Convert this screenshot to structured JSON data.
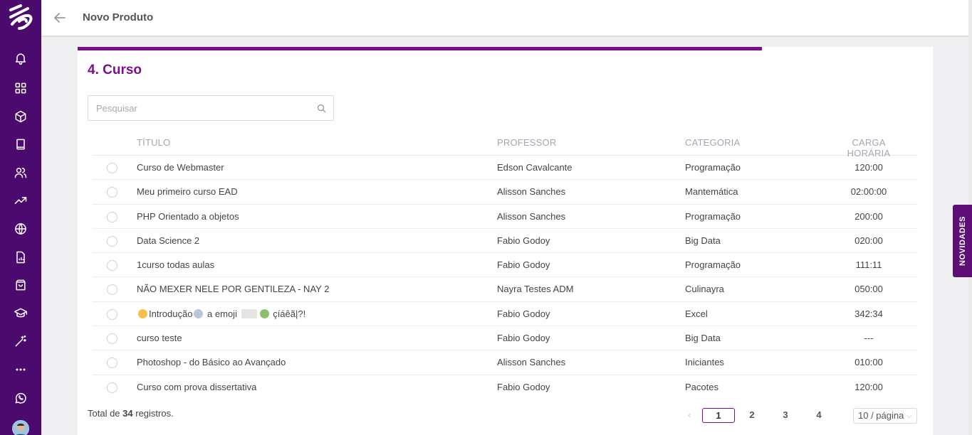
{
  "header": {
    "title": "Novo Produto"
  },
  "sidebar": {
    "items": [
      {
        "icon": "bell-icon",
        "name": "notifications"
      },
      {
        "icon": "grid-icon",
        "name": "dashboard"
      },
      {
        "icon": "cube-icon",
        "name": "products"
      },
      {
        "icon": "book-icon",
        "name": "courses"
      },
      {
        "icon": "users-icon",
        "name": "users"
      },
      {
        "icon": "trend-icon",
        "name": "reports"
      },
      {
        "icon": "globe-icon",
        "name": "site"
      },
      {
        "icon": "document-chart-icon",
        "name": "documents"
      },
      {
        "icon": "bag-icon",
        "name": "store"
      },
      {
        "icon": "graduation-cap-icon",
        "name": "academic"
      },
      {
        "icon": "magic-wand-icon",
        "name": "automation"
      },
      {
        "icon": "more-icon",
        "name": "more"
      },
      {
        "icon": "whatsapp-icon",
        "name": "whatsapp"
      }
    ]
  },
  "card": {
    "progress_percent": 80,
    "section_title": "4. Curso",
    "search_placeholder": "Pesquisar"
  },
  "table": {
    "columns": [
      "TÍTULO",
      "PROFESSOR",
      "CATEGORIA",
      "CARGA HORÁRIA"
    ],
    "rows": [
      {
        "title": "Curso de Webmaster",
        "professor": "Edson Cavalcante",
        "category": "Programação",
        "hours": "120:00"
      },
      {
        "title": "Meu primeiro curso EAD",
        "professor": "Alisson Sanches",
        "category": "Mantemática",
        "hours": "02:00:00"
      },
      {
        "title": "PHP Orientado a objetos",
        "professor": "Alisson Sanches",
        "category": "Programação",
        "hours": "200:00"
      },
      {
        "title": "Data Science 2",
        "professor": "Fabio Godoy",
        "category": "Big Data",
        "hours": "020:00"
      },
      {
        "title": "1curso todas aulas",
        "professor": "Fabio Godoy",
        "category": "Programação",
        "hours": "111:11"
      },
      {
        "title": "NÃO MEXER NELE POR GENTILEZA - NAY 2",
        "professor": "Nayra Testes ADM",
        "category": "Culinayra",
        "hours": "050:00"
      },
      {
        "title_parts": [
          "Introdução",
          " a emoji ",
          " çíáêã|?!"
        ],
        "title_text": "Introdução a emoji çíáêã|?!",
        "professor": "Fabio Godoy",
        "category": "Excel",
        "hours": "342:34"
      },
      {
        "title": "curso teste",
        "professor": "Fabio Godoy",
        "category": "Big Data",
        "hours": "---"
      },
      {
        "title": "Photoshop - do Básico ao Avançado",
        "professor": "Alisson Sanches",
        "category": "Iniciantes",
        "hours": "010:00"
      },
      {
        "title": "Curso com prova dissertativa",
        "professor": "Fabio Godoy",
        "category": "Pacotes",
        "hours": "120:00"
      }
    ]
  },
  "footer": {
    "total_prefix": "Total de ",
    "total_count": "34",
    "total_suffix": " registros.",
    "pages": [
      "1",
      "2",
      "3",
      "4"
    ],
    "current_page": "1",
    "page_size": "10 / página"
  },
  "novidades_label": "NOVIDADES",
  "colors": {
    "sidebar": "#4b0a6e",
    "accent": "#7a0f8c",
    "novidades": "#5e0f77"
  }
}
